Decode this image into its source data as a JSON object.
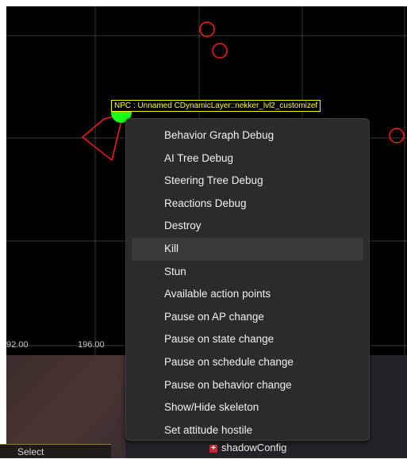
{
  "debug_view": {
    "axis_ticks": [
      "92.00",
      "196.00"
    ],
    "npc_label": "NPC : Unnamed CDynamicLayer::nekker_lvl2_customizef",
    "colors": {
      "grid": "#3a3a3a",
      "marker_red": "#ff1a1a",
      "npc_green": "#1aff1a",
      "label_yellow": "#ffff00"
    }
  },
  "context_menu": {
    "items": [
      {
        "label": "Behavior Graph Debug"
      },
      {
        "label": "AI Tree Debug"
      },
      {
        "label": "Steering Tree Debug"
      },
      {
        "label": "Reactions Debug"
      },
      {
        "label": "Destroy"
      },
      {
        "label": "Kill",
        "highlighted": true
      },
      {
        "label": "Stun"
      },
      {
        "label": "Available action points"
      },
      {
        "label": "Pause on AP change"
      },
      {
        "label": "Pause on state change"
      },
      {
        "label": "Pause on schedule change"
      },
      {
        "label": "Pause on behavior change"
      },
      {
        "label": "Show/Hide skeleton"
      },
      {
        "label": "Set attitude hostile"
      }
    ]
  },
  "property_tree": {
    "item_label": "shadowConfig",
    "item_icon": "plus-icon"
  }
}
